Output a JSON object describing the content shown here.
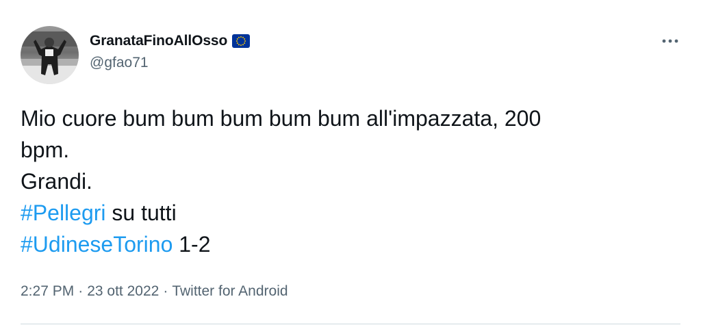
{
  "user": {
    "display_name": "GranataFinoAllOsso",
    "handle": "@gfao71",
    "badge_icon": "eu-flag-icon"
  },
  "tweet": {
    "line1": "Mio cuore bum bum bum bum bum all'impazzata, 200",
    "line2": "bpm.",
    "line3": "Grandi.",
    "hashtag1": "#Pellegri",
    "line4_rest": " su tutti",
    "hashtag2": "#UdineseTorino",
    "line5_rest": " 1-2"
  },
  "meta": {
    "time": "2:27 PM",
    "separator": "·",
    "date": "23 ott 2022",
    "source": "Twitter for Android"
  },
  "colors": {
    "link": "#1d9bf0",
    "secondary_text": "#536471",
    "flag_blue": "#003399",
    "flag_stars": "#ffcc00"
  }
}
